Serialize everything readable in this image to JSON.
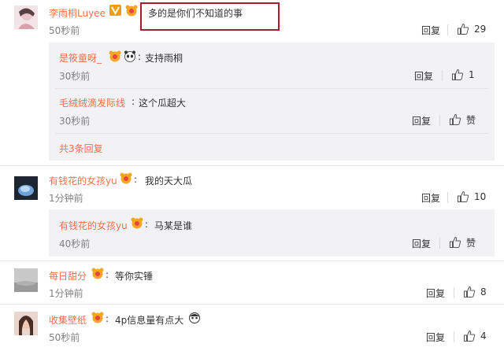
{
  "comments": [
    {
      "username": "李雨桐Luyee",
      "text": "多的是你们不知道的事",
      "time": "50秒前",
      "reply_label": "回复",
      "likes": "29",
      "replies": [
        {
          "username": "是筱童呀_",
          "text": "支持雨桐",
          "time": "30秒前",
          "reply_label": "回复",
          "likes": "1"
        },
        {
          "username": "毛绒绒滴发际线",
          "text": "这个瓜超大",
          "time": "30秒前",
          "reply_label": "回复",
          "likes": "赞"
        }
      ],
      "more_replies": "共3条回复"
    },
    {
      "username": "有钱花的女孩yu",
      "text": "我的天大瓜",
      "time": "1分钟前",
      "reply_label": "回复",
      "likes": "10",
      "replies": [
        {
          "username": "有钱花的女孩yu",
          "text": "马某是谁",
          "time": "40秒前",
          "reply_label": "回复",
          "likes": "赞"
        }
      ]
    },
    {
      "username": "每日甜分",
      "text": "等你实锤",
      "time": "1分钟前",
      "reply_label": "回复",
      "likes": "8"
    },
    {
      "username": "收集壁纸",
      "text": "4p信息量有点大",
      "time": "50秒前",
      "reply_label": "回复",
      "likes": "4"
    }
  ],
  "colors": {
    "username": "#eb7350",
    "highlight_box": "#a81e2a",
    "reply_background": "#f2f2f5",
    "timestamp": "#808080"
  }
}
